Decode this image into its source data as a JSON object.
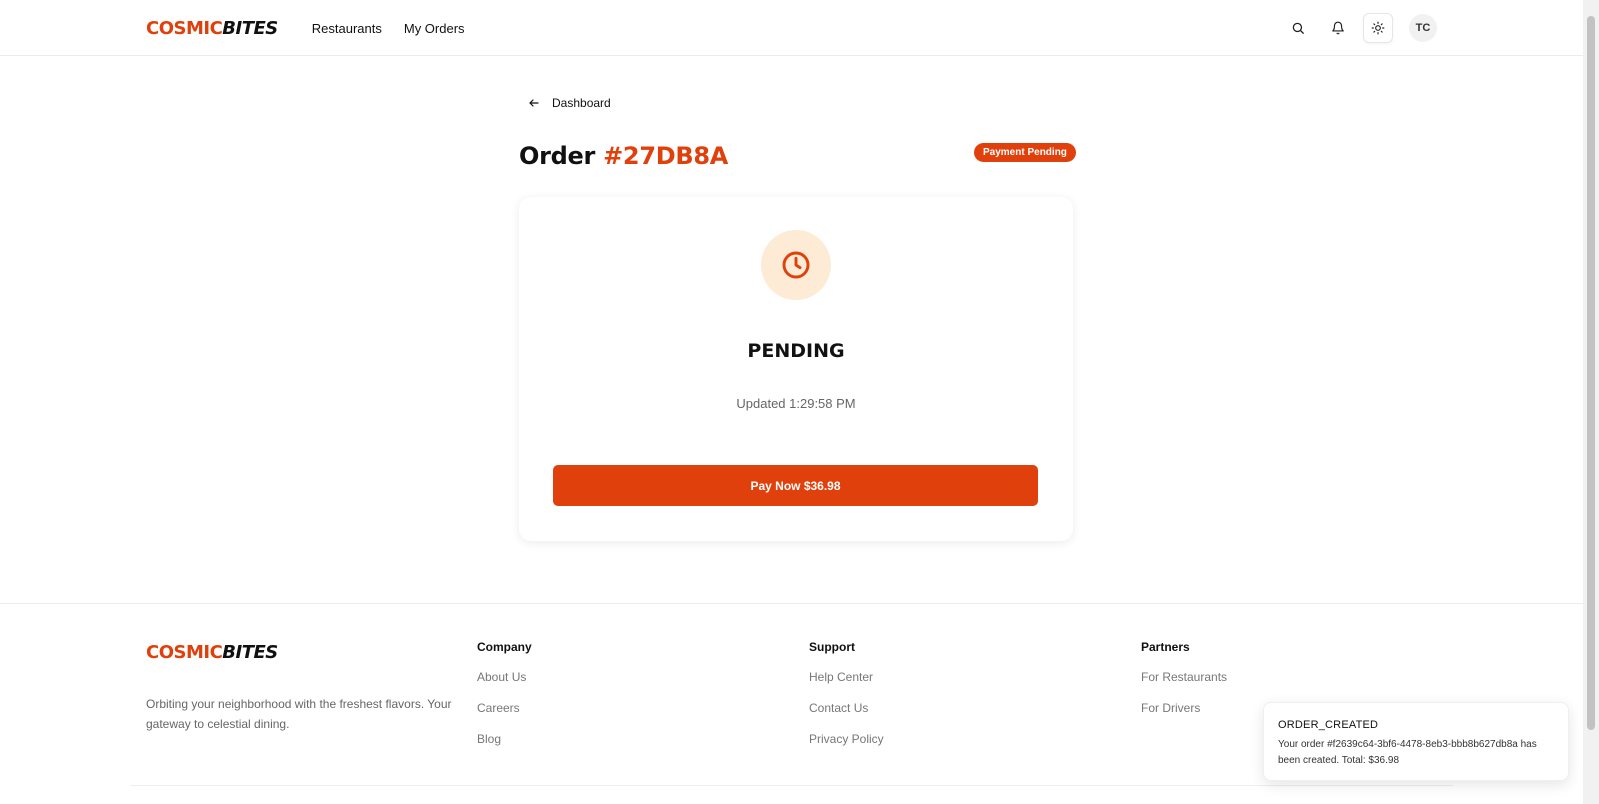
{
  "header": {
    "brand_part1": "COSMIC",
    "brand_part2": "BITES",
    "nav": [
      {
        "label": "Restaurants"
      },
      {
        "label": "My Orders"
      }
    ],
    "avatar_initials": "TC",
    "icons": [
      "search-icon",
      "bell-icon",
      "sun-icon"
    ]
  },
  "order": {
    "back_label": "Dashboard",
    "title_prefix": "Order",
    "id": "#27DB8A",
    "badge": "Payment Pending",
    "status": "PENDING",
    "updated": "Updated 1:29:58 PM",
    "pay_button": "Pay Now $36.98",
    "status_icon": "clock-icon"
  },
  "footer": {
    "brand_part1": "COSMIC",
    "brand_part2": "BITES",
    "tagline": "Orbiting your neighborhood with the freshest flavors. Your gateway to celestial dining.",
    "columns": [
      {
        "heading": "Company",
        "links": [
          "About Us",
          "Careers",
          "Blog"
        ]
      },
      {
        "heading": "Support",
        "links": [
          "Help Center",
          "Contact Us",
          "Privacy Policy"
        ]
      },
      {
        "heading": "Partners",
        "links": [
          "For Restaurants",
          "For Drivers"
        ]
      }
    ]
  },
  "toast": {
    "title": "ORDER_CREATED",
    "message": "Your order #f2639c64-3bf6-4478-8eb3-bbb8b627db8a has been created. Total: $36.98"
  },
  "colors": {
    "accent": "#e0410c",
    "clock_bg": "#fdebd6"
  }
}
